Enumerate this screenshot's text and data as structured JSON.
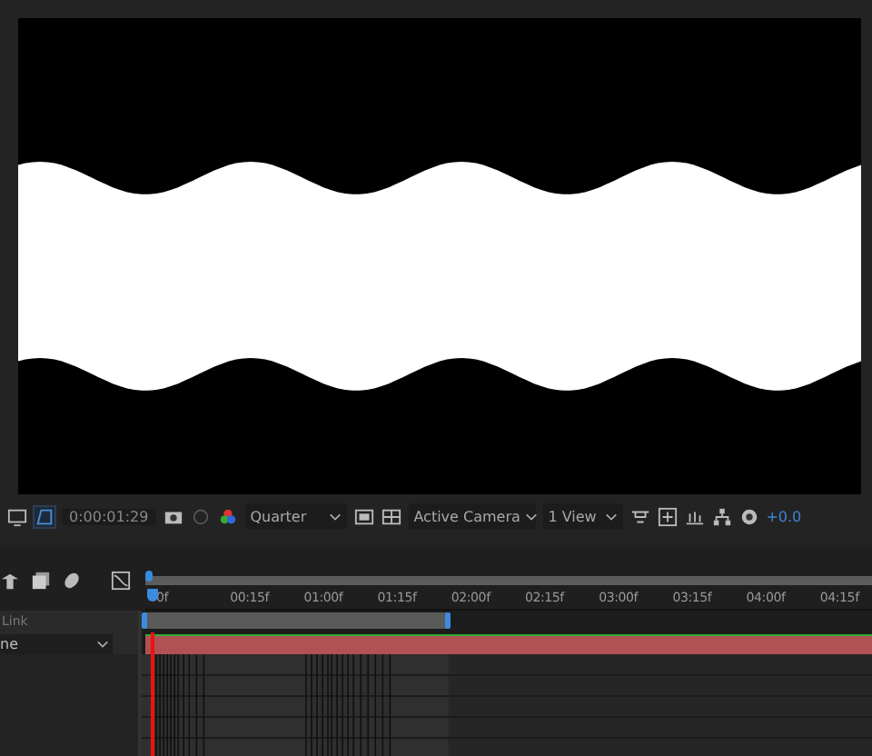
{
  "viewer": {
    "toolbar": {
      "timecode": "0:00:01:29",
      "resolution": "Quarter",
      "camera": "Active Camera",
      "views": "1 View",
      "exposure": "+0.0"
    }
  },
  "timeline": {
    "ruler": [
      "0f",
      "00:15f",
      "01:00f",
      "01:15f",
      "02:00f",
      "02:15f",
      "03:00f",
      "03:15f",
      "04:00f",
      "04:15f"
    ],
    "columns": {
      "parent_header": "Link",
      "parent_value": "ne"
    }
  }
}
